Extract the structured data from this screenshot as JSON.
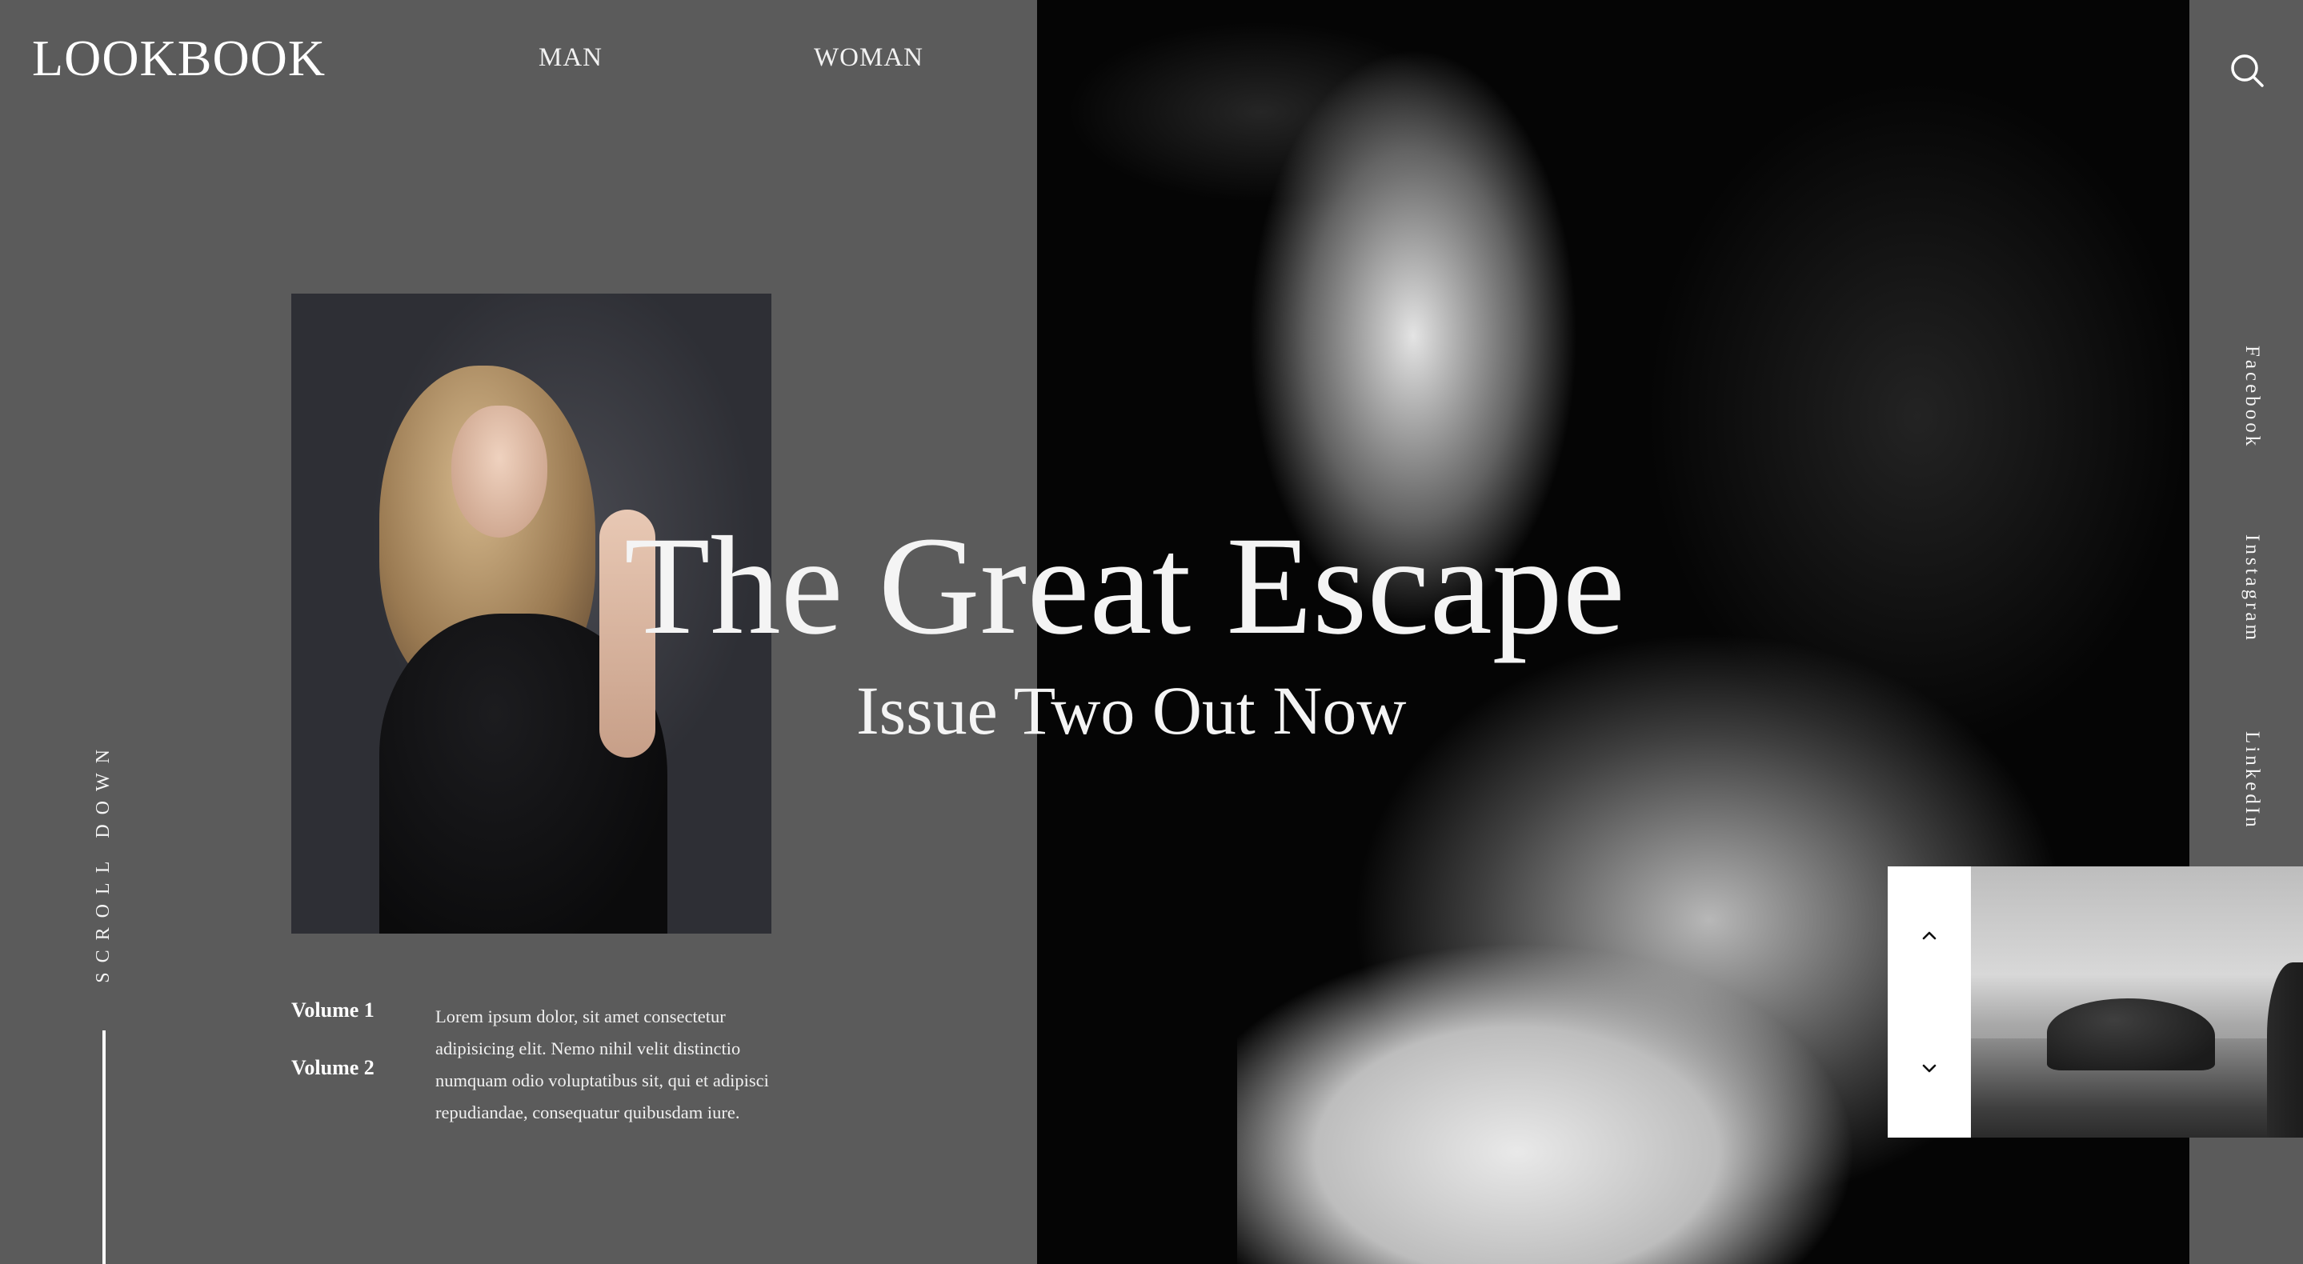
{
  "brand": "LOOKBOOK",
  "nav": {
    "man": "MAN",
    "woman": "WOMAN"
  },
  "hero": {
    "title": "The Great Escape",
    "subtitle": "Issue Two Out Now"
  },
  "scroll": {
    "label": "SCROLL DOWN"
  },
  "volumes": [
    {
      "label": "Volume 1"
    },
    {
      "label": "Volume 2"
    }
  ],
  "blurb": "Lorem ipsum dolor, sit amet consectetur adipisicing elit. Nemo nihil velit distinctio numquam odio voluptatibus sit, qui et adipisci repudiandae, consequatur quibusdam iure.",
  "social": {
    "facebook": "Facebook",
    "instagram": "Instagram",
    "linkedin": "LinkedIn"
  },
  "icons": {
    "search": "search-icon",
    "slider_up": "chevron-up-icon",
    "slider_down": "chevron-down-icon"
  },
  "colors": {
    "page_bg": "#5b5b5b",
    "hero_bg": "#050505",
    "text": "#ffffff"
  }
}
